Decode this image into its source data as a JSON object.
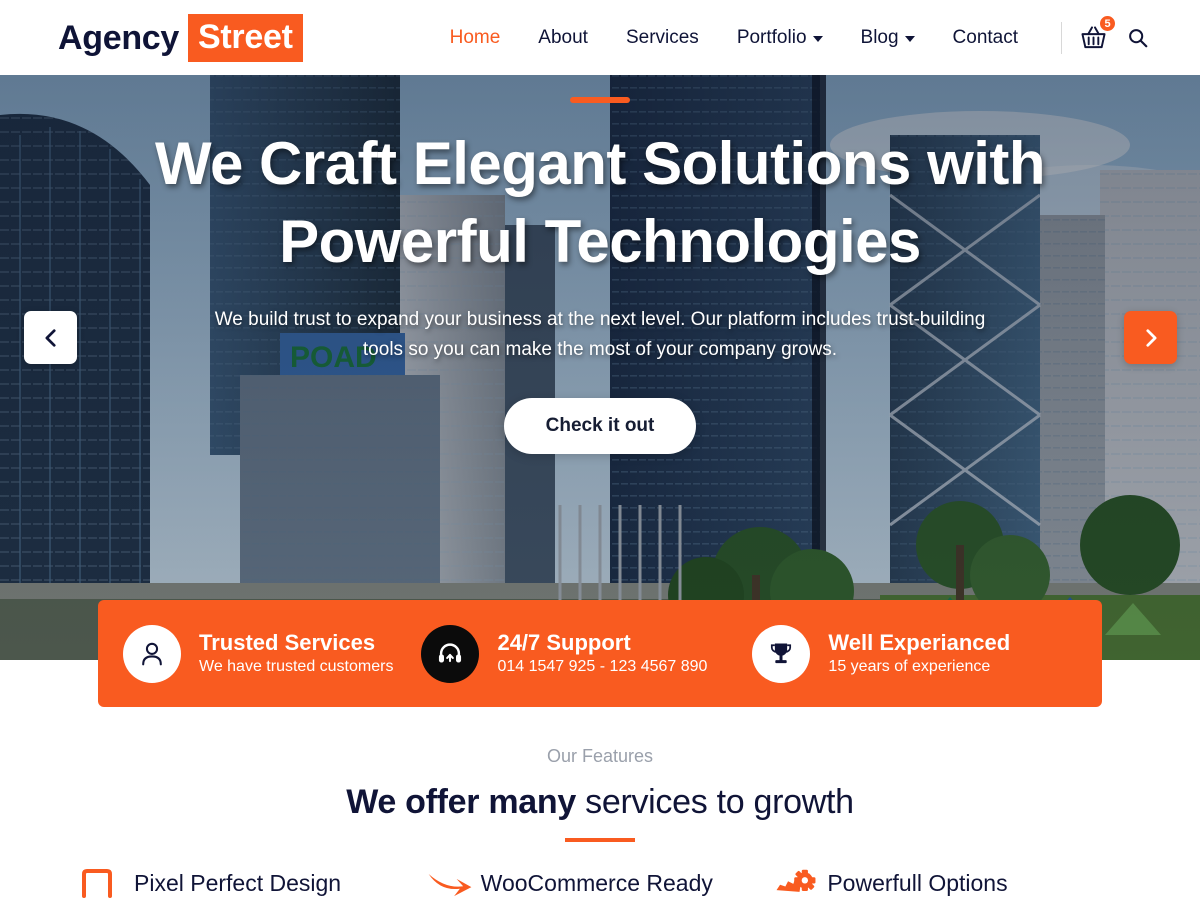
{
  "header": {
    "logo": {
      "primary": "Agency",
      "accent": "Street"
    },
    "nav": [
      {
        "label": "Home",
        "active": true,
        "dropdown": false
      },
      {
        "label": "About",
        "active": false,
        "dropdown": false
      },
      {
        "label": "Services",
        "active": false,
        "dropdown": false
      },
      {
        "label": "Portfolio",
        "active": false,
        "dropdown": true
      },
      {
        "label": "Blog",
        "active": false,
        "dropdown": true
      },
      {
        "label": "Contact",
        "active": false,
        "dropdown": false
      }
    ],
    "cart": {
      "icon": "basket-icon",
      "badge": "5"
    },
    "search": {
      "icon": "search-icon"
    }
  },
  "hero": {
    "title": "We Craft Elegant Solutions with Powerful Technologies",
    "subtitle": "We build trust to expand your business at the next level. Our platform includes trust-building tools so you can make the most of your company grows.",
    "cta": "Check it out",
    "prev_icon": "chevron-left-icon",
    "next_icon": "chevron-right-icon"
  },
  "feature_bar": {
    "items": [
      {
        "icon": "user-icon",
        "title": "Trusted Services",
        "desc": "We have trusted customers",
        "circle": "white"
      },
      {
        "icon": "headset-icon",
        "title": "24/7 Support",
        "desc": "014 1547 925 - 123 4567 890",
        "circle": "dark"
      },
      {
        "icon": "trophy-icon",
        "title": "Well Experianced",
        "desc": "15 years of experience",
        "circle": "white"
      }
    ]
  },
  "features": {
    "eyebrow": "Our Features",
    "title_bold": "We offer many",
    "title_rest": " services to growth",
    "cards": [
      {
        "icon": "frame-icon",
        "label": "Pixel Perfect Design"
      },
      {
        "icon": "swoosh-arrow-icon",
        "label": "WooCommerce Ready"
      },
      {
        "icon": "gears-icon",
        "label": "Powerfull Options"
      }
    ]
  },
  "colors": {
    "accent": "#f95b20",
    "dark": "#101437",
    "muted": "#9aa0ab"
  }
}
